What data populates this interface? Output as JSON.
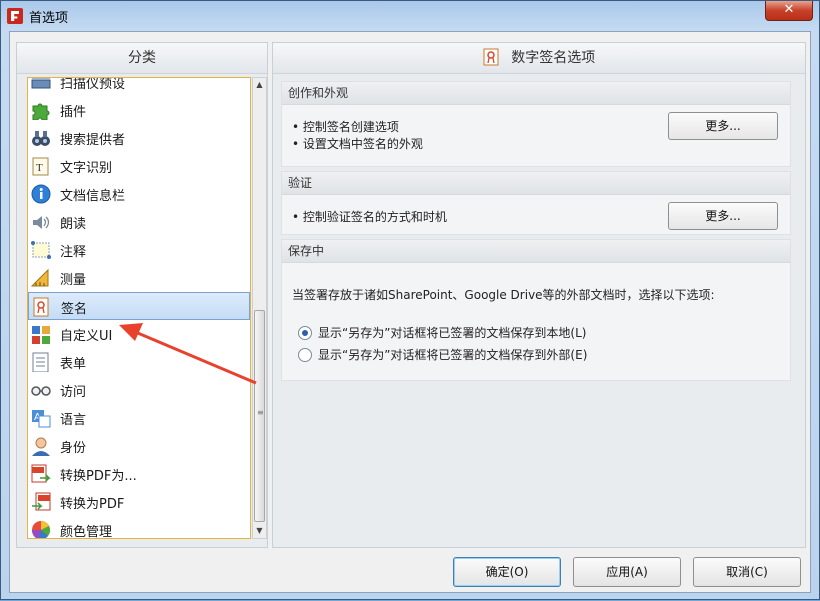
{
  "window": {
    "title": "首选项",
    "close_label": "✕"
  },
  "left": {
    "header": "分类",
    "items": [
      {
        "label": "扫描仪预设",
        "icon": "scanner-icon"
      },
      {
        "label": "插件",
        "icon": "puzzle-icon"
      },
      {
        "label": "搜索提供者",
        "icon": "binoculars-icon"
      },
      {
        "label": "文字识别",
        "icon": "ocr-icon"
      },
      {
        "label": "文档信息栏",
        "icon": "info-icon"
      },
      {
        "label": "朗读",
        "icon": "speaker-icon"
      },
      {
        "label": "注释",
        "icon": "annotation-icon"
      },
      {
        "label": "测量",
        "icon": "ruler-icon"
      },
      {
        "label": "签名",
        "icon": "signature-icon",
        "selected": true
      },
      {
        "label": "自定义UI",
        "icon": "custom-ui-icon"
      },
      {
        "label": "表单",
        "icon": "form-icon"
      },
      {
        "label": "访问",
        "icon": "glasses-icon"
      },
      {
        "label": "语言",
        "icon": "language-icon"
      },
      {
        "label": "身份",
        "icon": "identity-icon"
      },
      {
        "label": "转换PDF为...",
        "icon": "convert-from-pdf-icon"
      },
      {
        "label": "转换为PDF",
        "icon": "convert-to-pdf-icon"
      },
      {
        "label": "颜色管理",
        "icon": "color-wheel-icon"
      }
    ]
  },
  "right": {
    "header": "数字签名选项",
    "groups": {
      "appearance": {
        "title": "创作和外观",
        "lines": [
          "• 控制签名创建选项",
          "• 设置文档中签名的外观"
        ],
        "button": "更多..."
      },
      "validation": {
        "title": "验证",
        "lines": [
          "• 控制验证签名的方式和时机"
        ],
        "button": "更多..."
      },
      "saving": {
        "title": "保存中",
        "text": "当签署存放于诸如SharePoint、Google Drive等的外部文档时，选择以下选项:",
        "options": [
          {
            "label": "显示“另存为”对话框将已签署的文档保存到本地(L)",
            "checked": true
          },
          {
            "label": "显示“另存为”对话框将已签署的文档保存到外部(E)",
            "checked": false
          }
        ]
      }
    }
  },
  "footer": {
    "ok": "确定(O)",
    "apply": "应用(A)",
    "cancel": "取消(C)"
  },
  "colors": {
    "accent": "#2f5ea8",
    "arrow": "#e8412c",
    "list_border": "#e3b443"
  }
}
